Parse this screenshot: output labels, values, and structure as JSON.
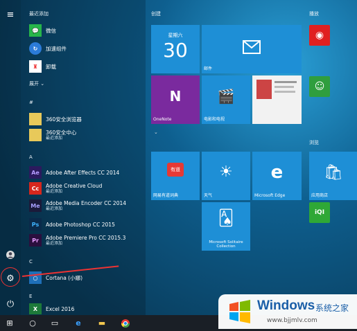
{
  "rail": {
    "icons": [
      "hamburger-icon",
      "user-icon",
      "settings-gear-icon",
      "power-icon"
    ]
  },
  "recent": {
    "heading": "最近添加",
    "apps": [
      {
        "name": "微信",
        "color": "#27b54a"
      },
      {
        "name": "加速组件",
        "color": "#2b7bd8"
      },
      {
        "name": "卸载",
        "color": "#ffffff"
      }
    ],
    "expand_label": "展开"
  },
  "sections": [
    {
      "letter": "#",
      "items": [
        {
          "name": "360安全浏览器",
          "sub": "",
          "folder": true
        },
        {
          "name": "360安全中心",
          "sub": "最近添加",
          "folder": true
        }
      ]
    },
    {
      "letter": "A",
      "items": [
        {
          "name": "Adobe After Effects CC 2014",
          "sub": "",
          "color": "#2b1a5e",
          "abbr": "Ae"
        },
        {
          "name": "Adobe Creative Cloud",
          "sub": "最近添加",
          "color": "#d6271d",
          "abbr": "Cc"
        },
        {
          "name": "Adobe Media Encoder CC 2014",
          "sub": "最近添加",
          "color": "#1b1a3a",
          "abbr": "Me"
        },
        {
          "name": "Adobe Photoshop CC 2015",
          "sub": "",
          "color": "#0a2a4a",
          "abbr": "Ps"
        },
        {
          "name": "Adobe Premiere Pro CC 2015.3",
          "sub": "最近添加",
          "color": "#2a0f3e",
          "abbr": "Pr"
        }
      ]
    },
    {
      "letter": "C",
      "items": [
        {
          "name": "Cortana (小娜)",
          "sub": "",
          "color": "#1e6fb8",
          "abbr": "○"
        }
      ]
    },
    {
      "letter": "E",
      "items": [
        {
          "name": "Excel 2016",
          "sub": "",
          "color": "#1d7a3a",
          "abbr": "X"
        }
      ]
    }
  ],
  "groups": {
    "create": "创建",
    "play": "播放",
    "browse": "浏览"
  },
  "tiles": {
    "calendar_day": "星期六",
    "calendar_date": "30",
    "mail": "邮件",
    "onenote": "OneNote",
    "movies": "电影和电视",
    "netease": "网易有道词典",
    "weather": "天气",
    "edge": "Microsoft Edge",
    "store": "应用商店",
    "solitaire": "Microsoft Solitaire Collection"
  },
  "taskbar": {
    "items": [
      "start",
      "search",
      "task-view",
      "edge",
      "file-explorer",
      "chrome"
    ]
  },
  "watermark": {
    "brand": "Windows",
    "cn": "系统之家",
    "url": "www.bjjmlv.com"
  },
  "colors": {
    "annotation": "#e33333",
    "tile_blue": "#1e8fd6",
    "onenote": "#7a2a9e"
  }
}
